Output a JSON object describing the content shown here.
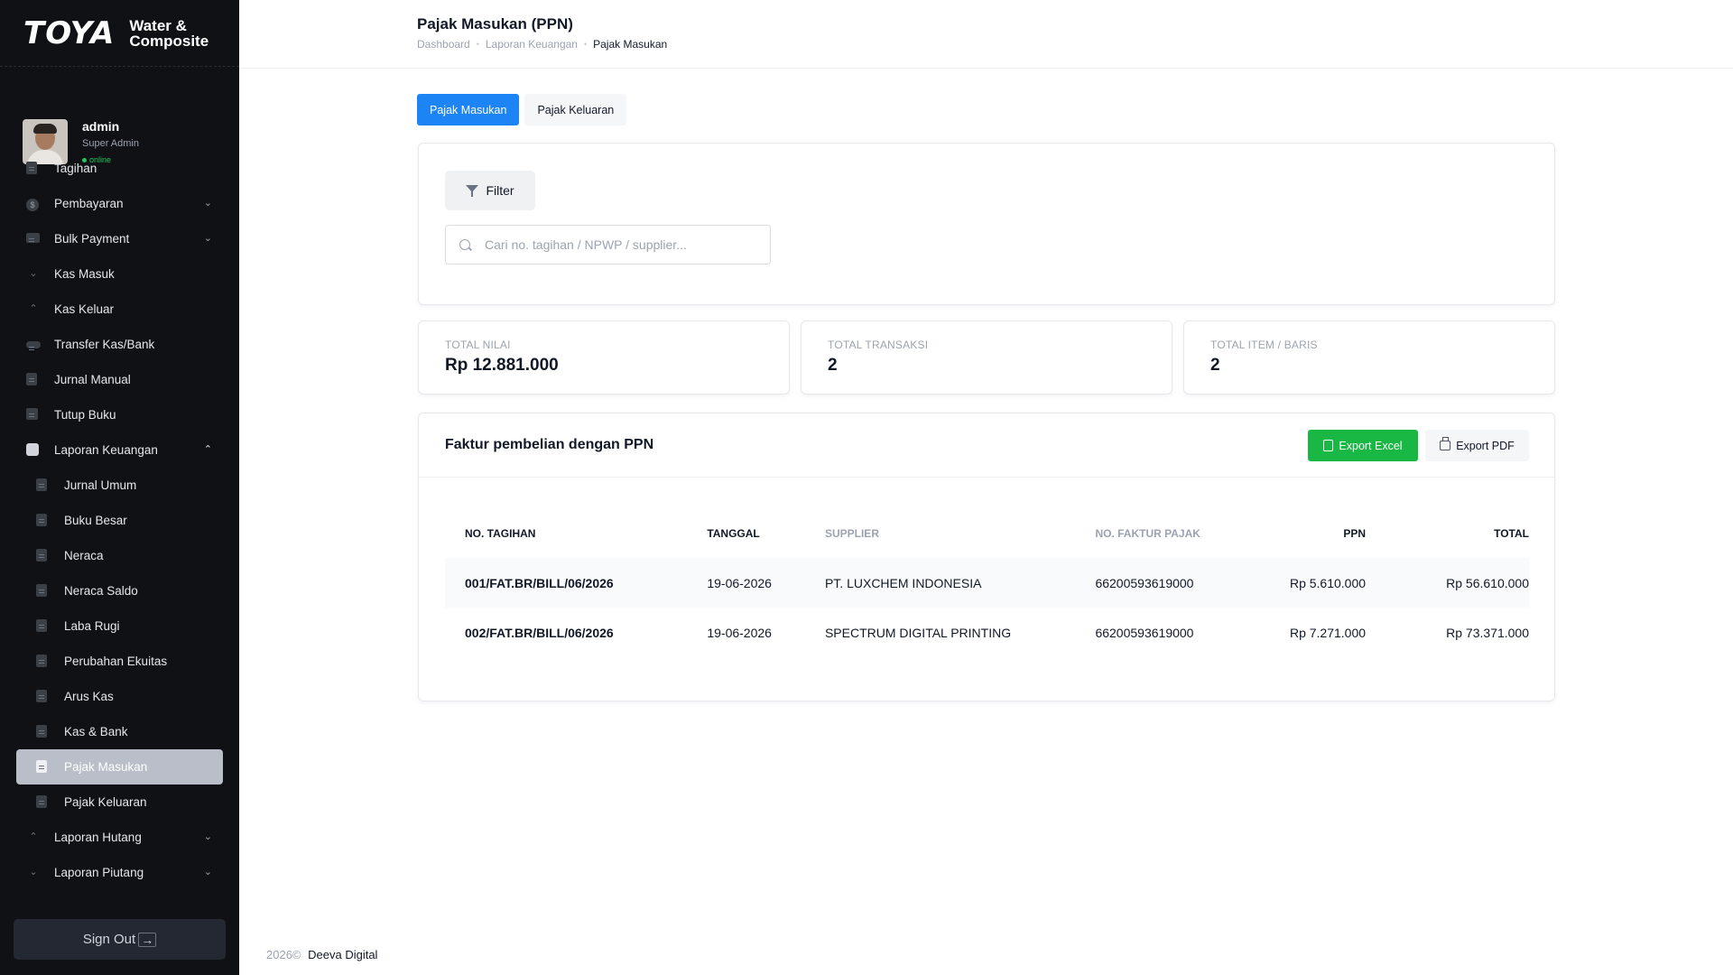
{
  "brand": {
    "name": "TOYA",
    "sub_line1": "Water &",
    "sub_line2": "Composite"
  },
  "user": {
    "name": "admin",
    "role": "Super Admin",
    "status": "online"
  },
  "sidebar": {
    "items": [
      {
        "label": "Tagihan",
        "icon": "document-icon"
      },
      {
        "label": "Pembayaran",
        "icon": "dollar-icon",
        "chevron": "chevron-down-icon"
      },
      {
        "label": "Bulk Payment",
        "icon": "card-icon",
        "chevron": "chevron-down-icon"
      },
      {
        "label": "Kas Masuk",
        "icon": "arrow-down-icon"
      },
      {
        "label": "Kas Keluar",
        "icon": "arrow-up-icon"
      },
      {
        "label": "Transfer Kas/Bank",
        "icon": "toggle-icon"
      },
      {
        "label": "Jurnal Manual",
        "icon": "document-icon"
      },
      {
        "label": "Tutup Buku",
        "icon": "calendar-icon"
      },
      {
        "label": "Laporan Keuangan",
        "icon": "chart-icon",
        "chevron": "chevron-up-icon"
      },
      {
        "label": "Jurnal Umum",
        "icon": "document-icon"
      },
      {
        "label": "Buku Besar",
        "icon": "document-icon"
      },
      {
        "label": "Neraca",
        "icon": "document-icon"
      },
      {
        "label": "Neraca Saldo",
        "icon": "document-icon"
      },
      {
        "label": "Laba Rugi",
        "icon": "document-icon"
      },
      {
        "label": "Perubahan Ekuitas",
        "icon": "document-icon"
      },
      {
        "label": "Arus Kas",
        "icon": "document-icon"
      },
      {
        "label": "Kas & Bank",
        "icon": "document-icon"
      },
      {
        "label": "Pajak Masukan",
        "icon": "document-icon",
        "active": true
      },
      {
        "label": "Pajak Keluaran",
        "icon": "document-icon"
      },
      {
        "label": "Laporan Hutang",
        "icon": "arrow-up-icon",
        "chevron": "chevron-down-icon"
      },
      {
        "label": "Laporan Piutang",
        "icon": "arrow-down-icon",
        "chevron": "chevron-down-icon"
      }
    ],
    "signout_label": "Sign Out"
  },
  "header": {
    "title": "Pajak Masukan (PPN)",
    "breadcrumb": [
      "Dashboard",
      "Laporan Keuangan",
      "Pajak Masukan"
    ]
  },
  "tabs": [
    {
      "label": "Pajak Masukan",
      "active": true
    },
    {
      "label": "Pajak Keluaran",
      "active": false
    }
  ],
  "filter": {
    "button_label": "Filter",
    "search_placeholder": "Cari no. tagihan / NPWP / supplier...",
    "search_value": ""
  },
  "stats": [
    {
      "label": "TOTAL NILAI",
      "value": "Rp 12.881.000"
    },
    {
      "label": "TOTAL TRANSAKSI",
      "value": "2"
    },
    {
      "label": "TOTAL ITEM / BARIS",
      "value": "2"
    }
  ],
  "table": {
    "title": "Faktur pembelian dengan PPN",
    "export_excel_label": "Export Excel",
    "export_pdf_label": "Export PDF",
    "columns": [
      "NO. TAGIHAN",
      "TANGGAL",
      "SUPPLIER",
      "NO. FAKTUR PAJAK",
      "PPN",
      "TOTAL"
    ],
    "rows": [
      {
        "no_tagihan": "001/FAT.BR/BILL/06/2026",
        "tanggal": "19-06-2026",
        "supplier": "PT. LUXCHEM INDONESIA",
        "no_faktur": "66200593619000",
        "ppn": "Rp 5.610.000",
        "total": "Rp 56.610.000"
      },
      {
        "no_tagihan": "002/FAT.BR/BILL/06/2026",
        "tanggal": "19-06-2026",
        "supplier": "SPECTRUM DIGITAL PRINTING",
        "no_faktur": "66200593619000",
        "ppn": "Rp 7.271.000",
        "total": "Rp 73.371.000"
      }
    ]
  },
  "footer": {
    "year": "2026©",
    "company": "Deeva Digital"
  },
  "colors": {
    "primary": "#1d84f5",
    "success": "#19b844",
    "sidebar_bg": "#0f1115",
    "active_item": "#b9bec8"
  }
}
